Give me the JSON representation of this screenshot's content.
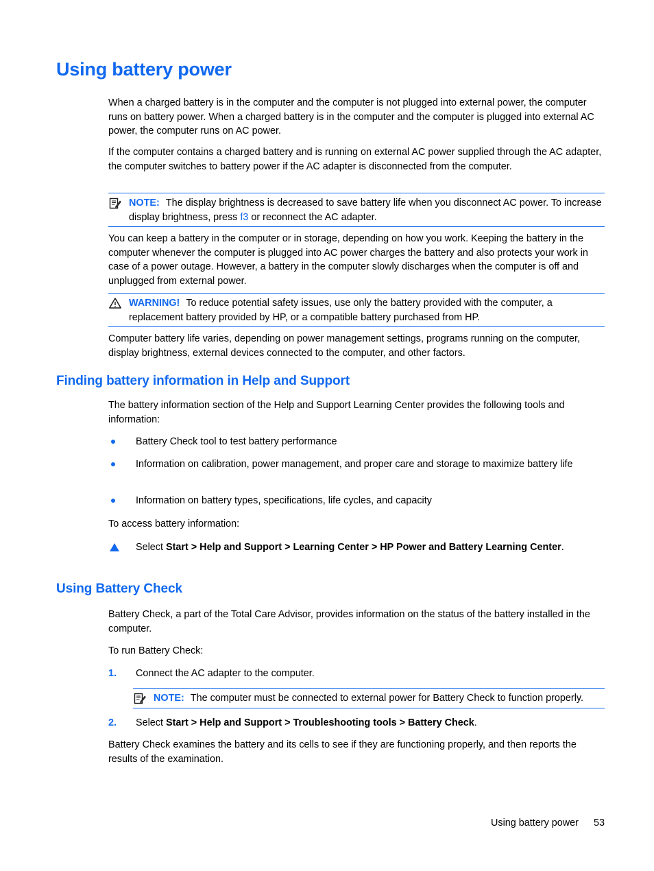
{
  "document": {
    "title": "Using battery power",
    "intro_paragraphs": [
      "When a charged battery is in the computer and the computer is not plugged into external power, the computer runs on battery power. When a charged battery is in the computer and the computer is plugged into external AC power, the computer runs on AC power.",
      "If the computer contains a charged battery and is running on external AC power supplied through the AC adapter, the computer switches to battery power if the AC adapter is disconnected from the computer."
    ],
    "note1": {
      "icon": "note-pencil-icon",
      "label": "NOTE:",
      "text_before_key": "The display brightness is decreased to save battery life when you disconnect AC power. To increase display brightness, press ",
      "key": "f3",
      "text_after_key": " or reconnect the AC adapter."
    },
    "paragraph_storage": "You can keep a battery in the computer or in storage, depending on how you work. Keeping the battery in the computer whenever the computer is plugged into AC power charges the battery and also protects your work in case of a power outage. However, a battery in the computer slowly discharges when the computer is off and unplugged from external power.",
    "warning": {
      "icon": "warning-triangle-icon",
      "label": "WARNING!",
      "text": "To reduce potential safety issues, use only the battery provided with the computer, a replacement battery provided by HP, or a compatible battery purchased from HP."
    },
    "paragraph_life": "Computer battery life varies, depending on power management settings, programs running on the computer, display brightness, external devices connected to the computer, and other factors."
  },
  "section_finding": {
    "heading": "Finding battery information in Help and Support",
    "intro": "The battery information section of the Help and Support Learning Center provides the following tools and information:",
    "bullets": [
      "Battery Check tool to test battery performance",
      "Information on calibration, power management, and proper care and storage to maximize battery life",
      "Information on battery types, specifications, life cycles, and capacity"
    ],
    "access_lead": "To access battery information:",
    "step": {
      "marker": "triangle-bullet",
      "prefix": "Select ",
      "path": "Start > Help and Support > Learning Center > HP Power and Battery Learning Center",
      "suffix": "."
    }
  },
  "section_battery_check": {
    "heading": "Using Battery Check",
    "intro": "Battery Check, a part of the Total Care Advisor, provides information on the status of the battery installed in the computer.",
    "run_lead": "To run Battery Check:",
    "steps": [
      {
        "number": "1.",
        "text": "Connect the AC adapter to the computer."
      },
      {
        "number": "2.",
        "prefix": "Select ",
        "path": "Start > Help and Support > Troubleshooting tools > Battery Check",
        "suffix": "."
      }
    ],
    "note2": {
      "icon": "note-pencil-icon",
      "label": "NOTE:",
      "text": "The computer must be connected to external power for Battery Check to function properly."
    },
    "closing": "Battery Check examines the battery and its cells to see if they are functioning properly, and then reports the results of the examination."
  },
  "footer": {
    "running_title": "Using battery power",
    "page_number": "53"
  },
  "colors": {
    "heading_blue": "#1169ef",
    "accent_blue": "#1169ef",
    "body_black": "#000000"
  }
}
